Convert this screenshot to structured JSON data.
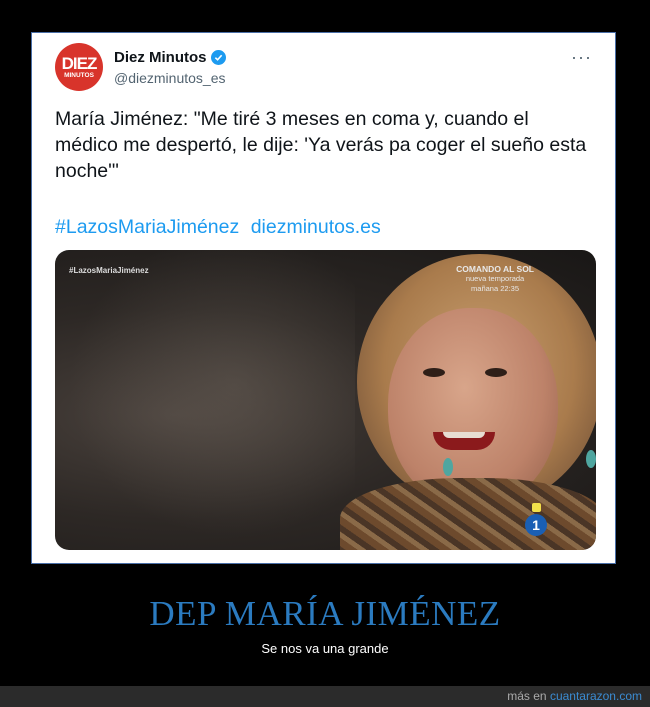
{
  "tweet": {
    "avatar_line1": "DIEZ",
    "avatar_line2": "MINUTOS",
    "author_name": "Diez Minutos",
    "handle": "@diezminutos_es",
    "more_label": "···",
    "text": "María Jiménez: \"Me tiré 3 meses en coma y, cuando el médico me despertó, le dije: 'Ya verás pa coger el sueño esta noche'\"",
    "hashtag": "#LazosMariaJiménez",
    "link": "diezminutos.es",
    "media": {
      "tag": "#LazosMariaJiménez",
      "promo_title": "COMANDO AL SOL",
      "promo_line2": "nueva temporada",
      "promo_line3": "mañana 22:35",
      "channel_logo": "1"
    }
  },
  "headline": "DEP MARÍA JIMÉNEZ",
  "subline": "Se nos va una grande",
  "footer": {
    "prefix": "más en",
    "site": "cuantarazon.com"
  },
  "colors": {
    "verified": "#1d9bf0",
    "link": "#1d9bf0",
    "headline": "#2b7bc0",
    "avatar": "#d8342b"
  }
}
